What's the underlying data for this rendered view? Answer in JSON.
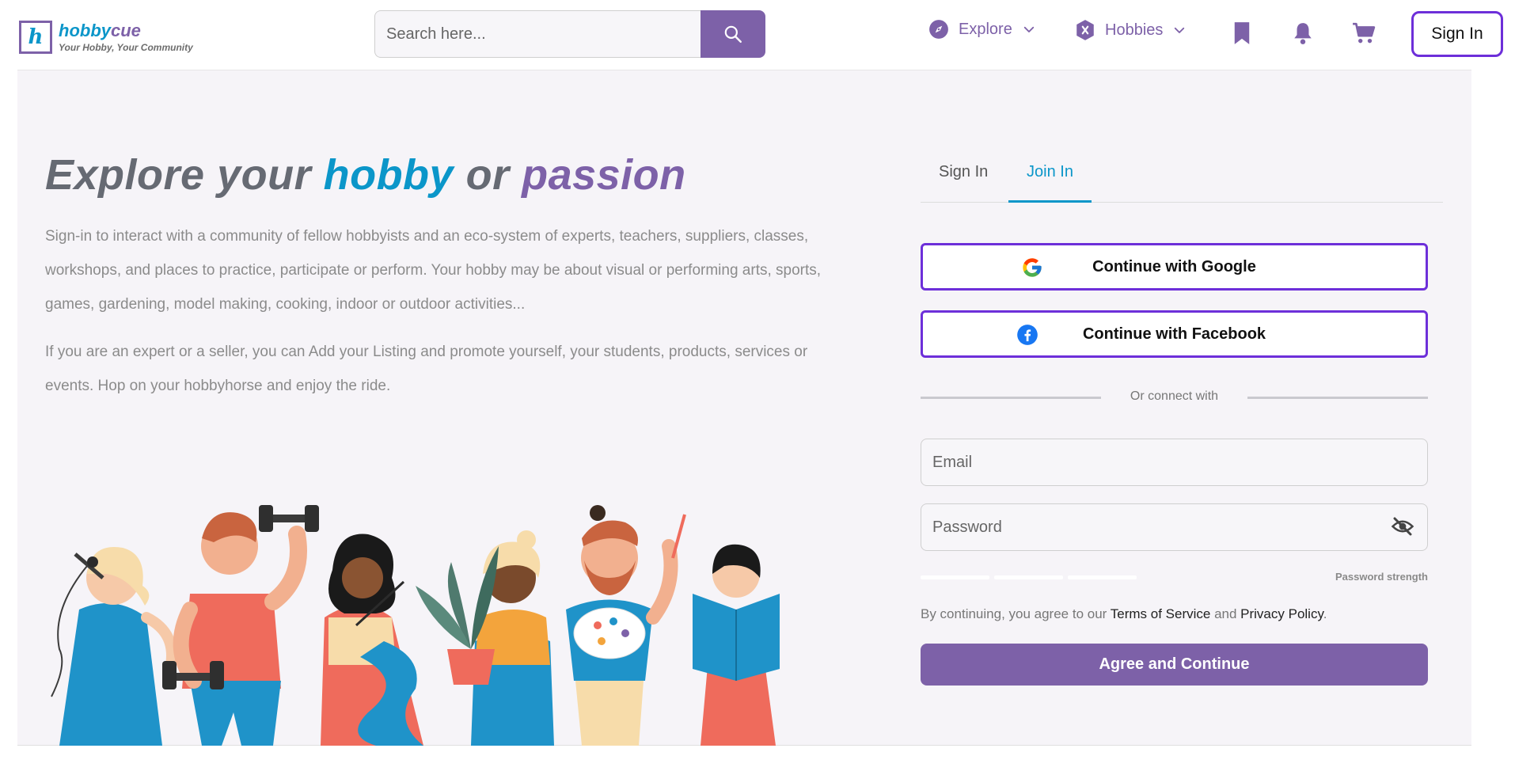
{
  "header": {
    "logo_letter": "h",
    "logo_name_a": "hobby",
    "logo_name_b": "cue",
    "logo_tagline": "Your Hobby, Your Community",
    "search_placeholder": "Search here...",
    "nav": {
      "explore_label": "Explore",
      "hobbies_label": "Hobbies"
    },
    "signin_label": "Sign In"
  },
  "hero": {
    "title_part1": "Explore your ",
    "title_hobby": "hobby",
    "title_or": " or ",
    "title_passion": "passion",
    "paragraph1": "Sign-in to interact with a community of fellow hobbyists and an eco-system of experts, teachers, suppliers, classes, workshops, and places to practice, participate or perform. Your hobby may be about visual or performing arts, sports, games, gardening, model making, cooking, indoor or outdoor activities...",
    "paragraph2": "If you are an expert or a seller, you can Add your Listing and promote yourself, your students, products, services or events. Hop on your hobbyhorse and enjoy the ride."
  },
  "auth": {
    "tabs": [
      {
        "label": "Sign In",
        "active": false
      },
      {
        "label": "Join In",
        "active": true
      }
    ],
    "google_label": "Continue with Google",
    "facebook_label": "Continue with Facebook",
    "divider_text": "Or connect with",
    "email_placeholder": "Email",
    "password_placeholder": "Password",
    "strength_label": "Password strength",
    "terms_prefix": "By continuing, you agree to our ",
    "terms_link": "Terms of Service",
    "terms_and": " and ",
    "privacy_link": "Privacy Policy",
    "terms_suffix": ".",
    "agree_label": "Agree and Continue"
  },
  "colors": {
    "brand_purple": "#7d61a8",
    "brand_blue": "#0b96c9",
    "button_border": "#6d2fd9",
    "panel_bg": "#f6f4f8"
  },
  "icons": [
    "search-icon",
    "compass-icon",
    "chevron-down-icon",
    "hobbies-icon",
    "bookmark-icon",
    "bell-icon",
    "cart-icon",
    "google-icon",
    "facebook-icon",
    "eye-off-icon"
  ]
}
